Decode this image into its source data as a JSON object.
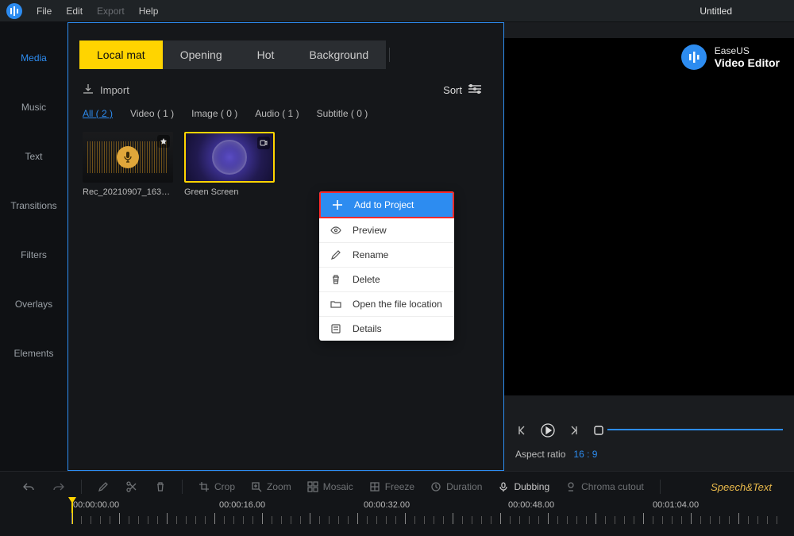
{
  "app": {
    "title": "Untitled"
  },
  "menu": {
    "file": "File",
    "edit": "Edit",
    "export": "Export",
    "help": "Help"
  },
  "brand": {
    "name1": "EaseUS",
    "name2": "Video Editor"
  },
  "sidebar": {
    "items": [
      {
        "label": "Media",
        "active": true
      },
      {
        "label": "Music"
      },
      {
        "label": "Text"
      },
      {
        "label": "Transitions"
      },
      {
        "label": "Filters"
      },
      {
        "label": "Overlays"
      },
      {
        "label": "Elements"
      }
    ]
  },
  "media_tabs": {
    "items": [
      {
        "label": "Local mat",
        "active": true
      },
      {
        "label": "Opening"
      },
      {
        "label": "Hot"
      },
      {
        "label": "Background"
      }
    ]
  },
  "import_label": "Import",
  "sort_label": "Sort",
  "filters": {
    "items": [
      {
        "label": "All ( 2 )",
        "active": true
      },
      {
        "label": "Video ( 1 )"
      },
      {
        "label": "Image ( 0 )"
      },
      {
        "label": "Audio ( 1 )"
      },
      {
        "label": "Subtitle ( 0 )"
      }
    ]
  },
  "thumbs": {
    "audio_name": "Rec_20210907_1635...",
    "video_name": "Green Screen"
  },
  "context_menu": {
    "add": "Add to Project",
    "preview": "Preview",
    "rename": "Rename",
    "delete": "Delete",
    "open_loc": "Open the file location",
    "details": "Details"
  },
  "preview": {
    "aspect_label": "Aspect ratio",
    "aspect_value": "16 : 9"
  },
  "toolbar": {
    "crop": "Crop",
    "zoom": "Zoom",
    "mosaic": "Mosaic",
    "freeze": "Freeze",
    "duration": "Duration",
    "dubbing": "Dubbing",
    "chroma": "Chroma cutout",
    "speech": "Speech&Text"
  },
  "timeline": {
    "start": "00:00:00.00",
    "marks": [
      "00:00:16.00",
      "00:00:32.00",
      "00:00:48.00",
      "00:01:04.00"
    ]
  }
}
